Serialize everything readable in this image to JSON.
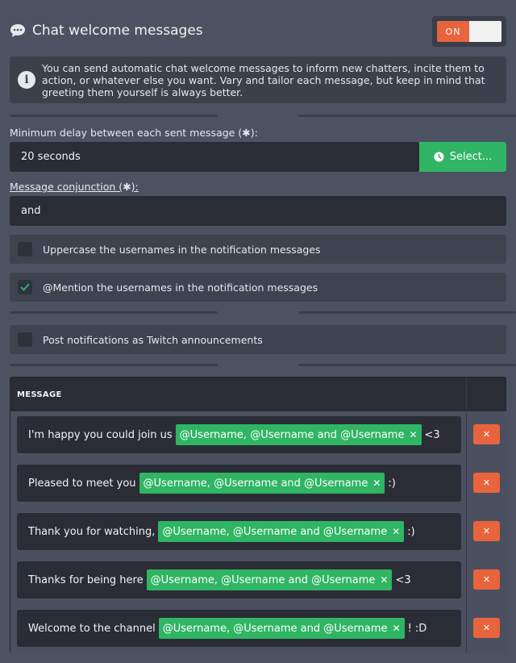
{
  "header": {
    "title": "Chat welcome messages",
    "toggle_on": "ON"
  },
  "info": {
    "text": "You can send automatic chat welcome messages to inform new chatters, incite them to action, or whatever else you want. Vary and tailor each message, but keep in mind that greeting them yourself is always better."
  },
  "delay": {
    "label": "Minimum delay between each sent message (",
    "label_end": "):",
    "star": "✱",
    "value": "20 seconds",
    "select_label": "Select..."
  },
  "conjunction": {
    "label": "Message conjunction (",
    "label_end": "):",
    "star": "✱",
    "value": "and"
  },
  "options": {
    "uppercase": {
      "label": "Uppercase the usernames in the notification messages",
      "checked": false
    },
    "mention": {
      "label": "@Mention the usernames in the notification messages",
      "checked": true
    },
    "announce": {
      "label": "Post notifications as Twitch announcements",
      "checked": false
    }
  },
  "table": {
    "header": "MESSAGE",
    "tag_text": "@Username, @Username and @Username",
    "tag_remove": "✕",
    "delete_label": "✕",
    "rows": [
      {
        "before": "I'm happy you could join us",
        "after": "<3"
      },
      {
        "before": "Pleased to meet you",
        "after": ":)"
      },
      {
        "before": "Thank you for watching,",
        "after": ":)"
      },
      {
        "before": "Thanks for being here",
        "after": "<3"
      },
      {
        "before": "Welcome to the channel",
        "after": "! :D"
      }
    ]
  },
  "colors": {
    "accent_green": "#2fb563",
    "accent_orange": "#e8643c",
    "background": "#4c5261"
  }
}
